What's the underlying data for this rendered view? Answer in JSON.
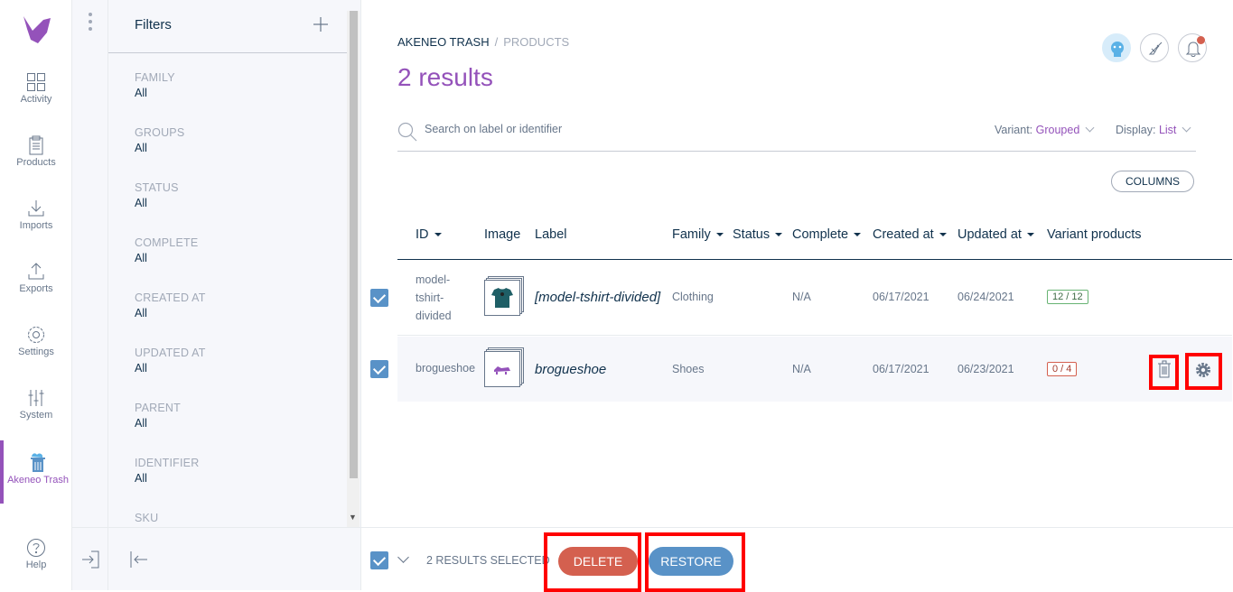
{
  "nav": {
    "items": [
      {
        "label": "Activity",
        "icon": "activity-icon"
      },
      {
        "label": "Products",
        "icon": "products-icon"
      },
      {
        "label": "Imports",
        "icon": "imports-icon"
      },
      {
        "label": "Exports",
        "icon": "exports-icon"
      },
      {
        "label": "Settings",
        "icon": "settings-icon"
      },
      {
        "label": "System",
        "icon": "system-icon"
      },
      {
        "label": "Akeneo Trash",
        "icon": "trash-app-icon",
        "active": true
      }
    ],
    "help_label": "Help"
  },
  "filters": {
    "title": "Filters",
    "items": [
      {
        "label": "FAMILY",
        "value": "All"
      },
      {
        "label": "GROUPS",
        "value": "All"
      },
      {
        "label": "STATUS",
        "value": "All"
      },
      {
        "label": "COMPLETE",
        "value": "All"
      },
      {
        "label": "CREATED AT",
        "value": "All"
      },
      {
        "label": "UPDATED AT",
        "value": "All"
      },
      {
        "label": "PARENT",
        "value": "All"
      },
      {
        "label": "IDENTIFIER",
        "value": "All"
      },
      {
        "label": "SKU",
        "value": ""
      }
    ]
  },
  "breadcrumb": {
    "root": "AKENEO TRASH",
    "separator": "/",
    "current": "PRODUCTS"
  },
  "results_title": "2 results",
  "search": {
    "placeholder": "Search on label or identifier",
    "value": ""
  },
  "variant_selector": {
    "label": "Variant:",
    "value": "Grouped"
  },
  "display_selector": {
    "label": "Display:",
    "value": "List"
  },
  "columns_button": "COLUMNS",
  "table": {
    "headers": {
      "id": "ID",
      "image": "Image",
      "label": "Label",
      "family": "Family",
      "status": "Status",
      "complete": "Complete",
      "created": "Created at",
      "updated": "Updated at",
      "variants": "Variant products"
    },
    "rows": [
      {
        "id": "model-tshirt-divided",
        "label": "[model-tshirt-divided]",
        "family": "Clothing",
        "complete": "N/A",
        "created": "06/17/2021",
        "updated": "06/24/2021",
        "variants": "12 / 12",
        "checked": true
      },
      {
        "id": "brogueshoe",
        "label": "brogueshoe",
        "family": "Shoes",
        "complete": "N/A",
        "created": "06/17/2021",
        "updated": "06/23/2021",
        "variants": "0 / 4",
        "checked": true
      }
    ]
  },
  "bottom_bar": {
    "selected_text": "2 RESULTS SELECTED",
    "delete_label": "DELETE",
    "restore_label": "RESTORE"
  },
  "colors": {
    "accent": "#9452ba",
    "primary": "#5992c7",
    "danger": "#d4604f",
    "highlight": "#ff0000"
  }
}
